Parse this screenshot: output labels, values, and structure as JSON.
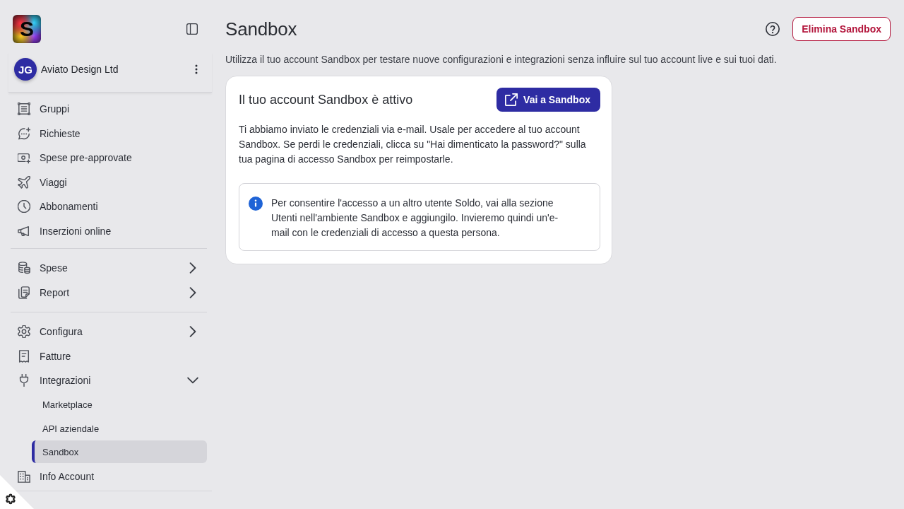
{
  "sidebar": {
    "logo": {
      "text": "S"
    },
    "account": {
      "initials": "JG",
      "name": "Aviato Design Ltd"
    },
    "sections": [
      {
        "items": [
          {
            "label": "Gruppi",
            "selected": false
          },
          {
            "label": "Richieste",
            "selected": false
          },
          {
            "label": "Spese pre-approvate",
            "selected": false
          },
          {
            "label": "Viaggi",
            "selected": false
          },
          {
            "label": "Abbonamenti",
            "selected": false
          },
          {
            "label": "Inserzioni online",
            "selected": false
          }
        ]
      },
      {
        "items": [
          {
            "label": "Spese",
            "selected": false,
            "expanded": false
          },
          {
            "label": "Report",
            "selected": false,
            "expanded": false
          }
        ]
      },
      {
        "items": [
          {
            "label": "Configura",
            "selected": false,
            "expanded": false
          },
          {
            "label": "Fatture",
            "selected": false
          },
          {
            "label": "Integrazioni",
            "selected": false,
            "expanded": true,
            "children": [
              {
                "label": "Marketplace",
                "selected": false
              },
              {
                "label": "API aziendale",
                "selected": false
              },
              {
                "label": "Sandbox",
                "selected": true
              }
            ]
          },
          {
            "label": "Info Account",
            "selected": false
          }
        ]
      }
    ]
  },
  "header": {
    "title": "Sandbox",
    "delete_button": "Elimina Sandbox",
    "description": "Utilizza il tuo account Sandbox per testare nuove configurazioni e integrazioni senza influire sul tuo account live e sui tuoi dati."
  },
  "card": {
    "title": "Il tuo account Sandbox è attivo",
    "button": "Vai a Sandbox",
    "body": "Ti abbiamo inviato le credenziali via e-mail. Usale per accedere al tuo account Sandbox. Se perdi le credenziali, clicca su \"Hai dimenticato la password?\" sulla tua pagina di accesso Sandbox per reimpostarle.",
    "info": "Per consentire l'accesso a un altro utente Soldo, vai alla sezione Utenti nell'ambiente Sandbox e aggiungilo. Invieremo quindi un'e-mail con le credenziali di accesso a questa persona."
  }
}
